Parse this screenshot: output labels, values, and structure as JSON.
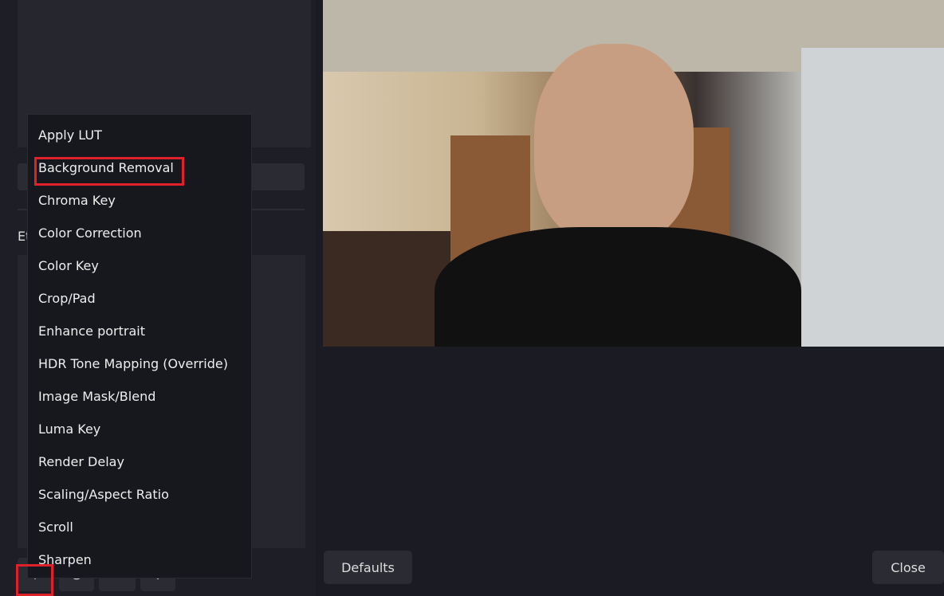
{
  "left_panel": {
    "section_label": "Et"
  },
  "toolbar": {
    "add": "+",
    "remove": "🗑",
    "move_up": "⌃",
    "move_down": "⌄"
  },
  "menu": {
    "items": [
      "Apply LUT",
      "Background Removal",
      "Chroma Key",
      "Color Correction",
      "Color Key",
      "Crop/Pad",
      "Enhance portrait",
      "HDR Tone Mapping (Override)",
      "Image Mask/Blend",
      "Luma Key",
      "Render Delay",
      "Scaling/Aspect Ratio",
      "Scroll",
      "Sharpen"
    ],
    "highlighted": "Background Removal"
  },
  "buttons": {
    "defaults": "Defaults",
    "close": "Close"
  },
  "colors": {
    "highlight": "#e0202a",
    "menu_bg": "#17181e"
  }
}
